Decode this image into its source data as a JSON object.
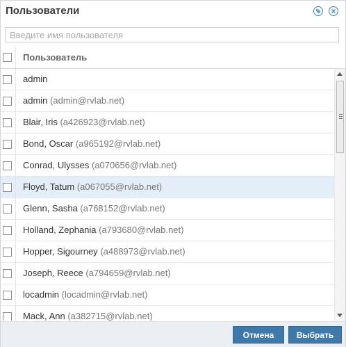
{
  "dialog": {
    "title": "Пользователи"
  },
  "search": {
    "placeholder": "Введите имя пользователя",
    "value": ""
  },
  "grid": {
    "header": "Пользователь",
    "rows": [
      {
        "name": "admin",
        "email": ""
      },
      {
        "name": "admin",
        "email": "(admin@rvlab.net)"
      },
      {
        "name": "Blair, Iris",
        "email": "(a426923@rvlab.net)"
      },
      {
        "name": "Bond, Oscar",
        "email": "(a965192@rvlab.net)"
      },
      {
        "name": "Conrad, Ulysses",
        "email": "(a070656@rvlab.net)"
      },
      {
        "name": "Floyd, Tatum",
        "email": "(a067055@rvlab.net)",
        "selected": true
      },
      {
        "name": "Glenn, Sasha",
        "email": "(a768152@rvlab.net)"
      },
      {
        "name": "Holland, Zephania",
        "email": "(a793680@rvlab.net)"
      },
      {
        "name": "Hopper, Sigourney",
        "email": "(a488973@rvlab.net)"
      },
      {
        "name": "Joseph, Reece",
        "email": "(a794659@rvlab.net)"
      },
      {
        "name": "locadmin",
        "email": "(locadmin@rvlab.net)"
      },
      {
        "name": "Mack, Ann",
        "email": "(a382715@rvlab.net)"
      }
    ]
  },
  "footer": {
    "cancel_label": "Отмена",
    "select_label": "Выбрать"
  },
  "icons": {
    "help": "help-icon",
    "close": "close-icon"
  },
  "colors": {
    "accent": "#3f79aa",
    "selected_row": "#e3eef9",
    "icon": "#3b84c4"
  }
}
